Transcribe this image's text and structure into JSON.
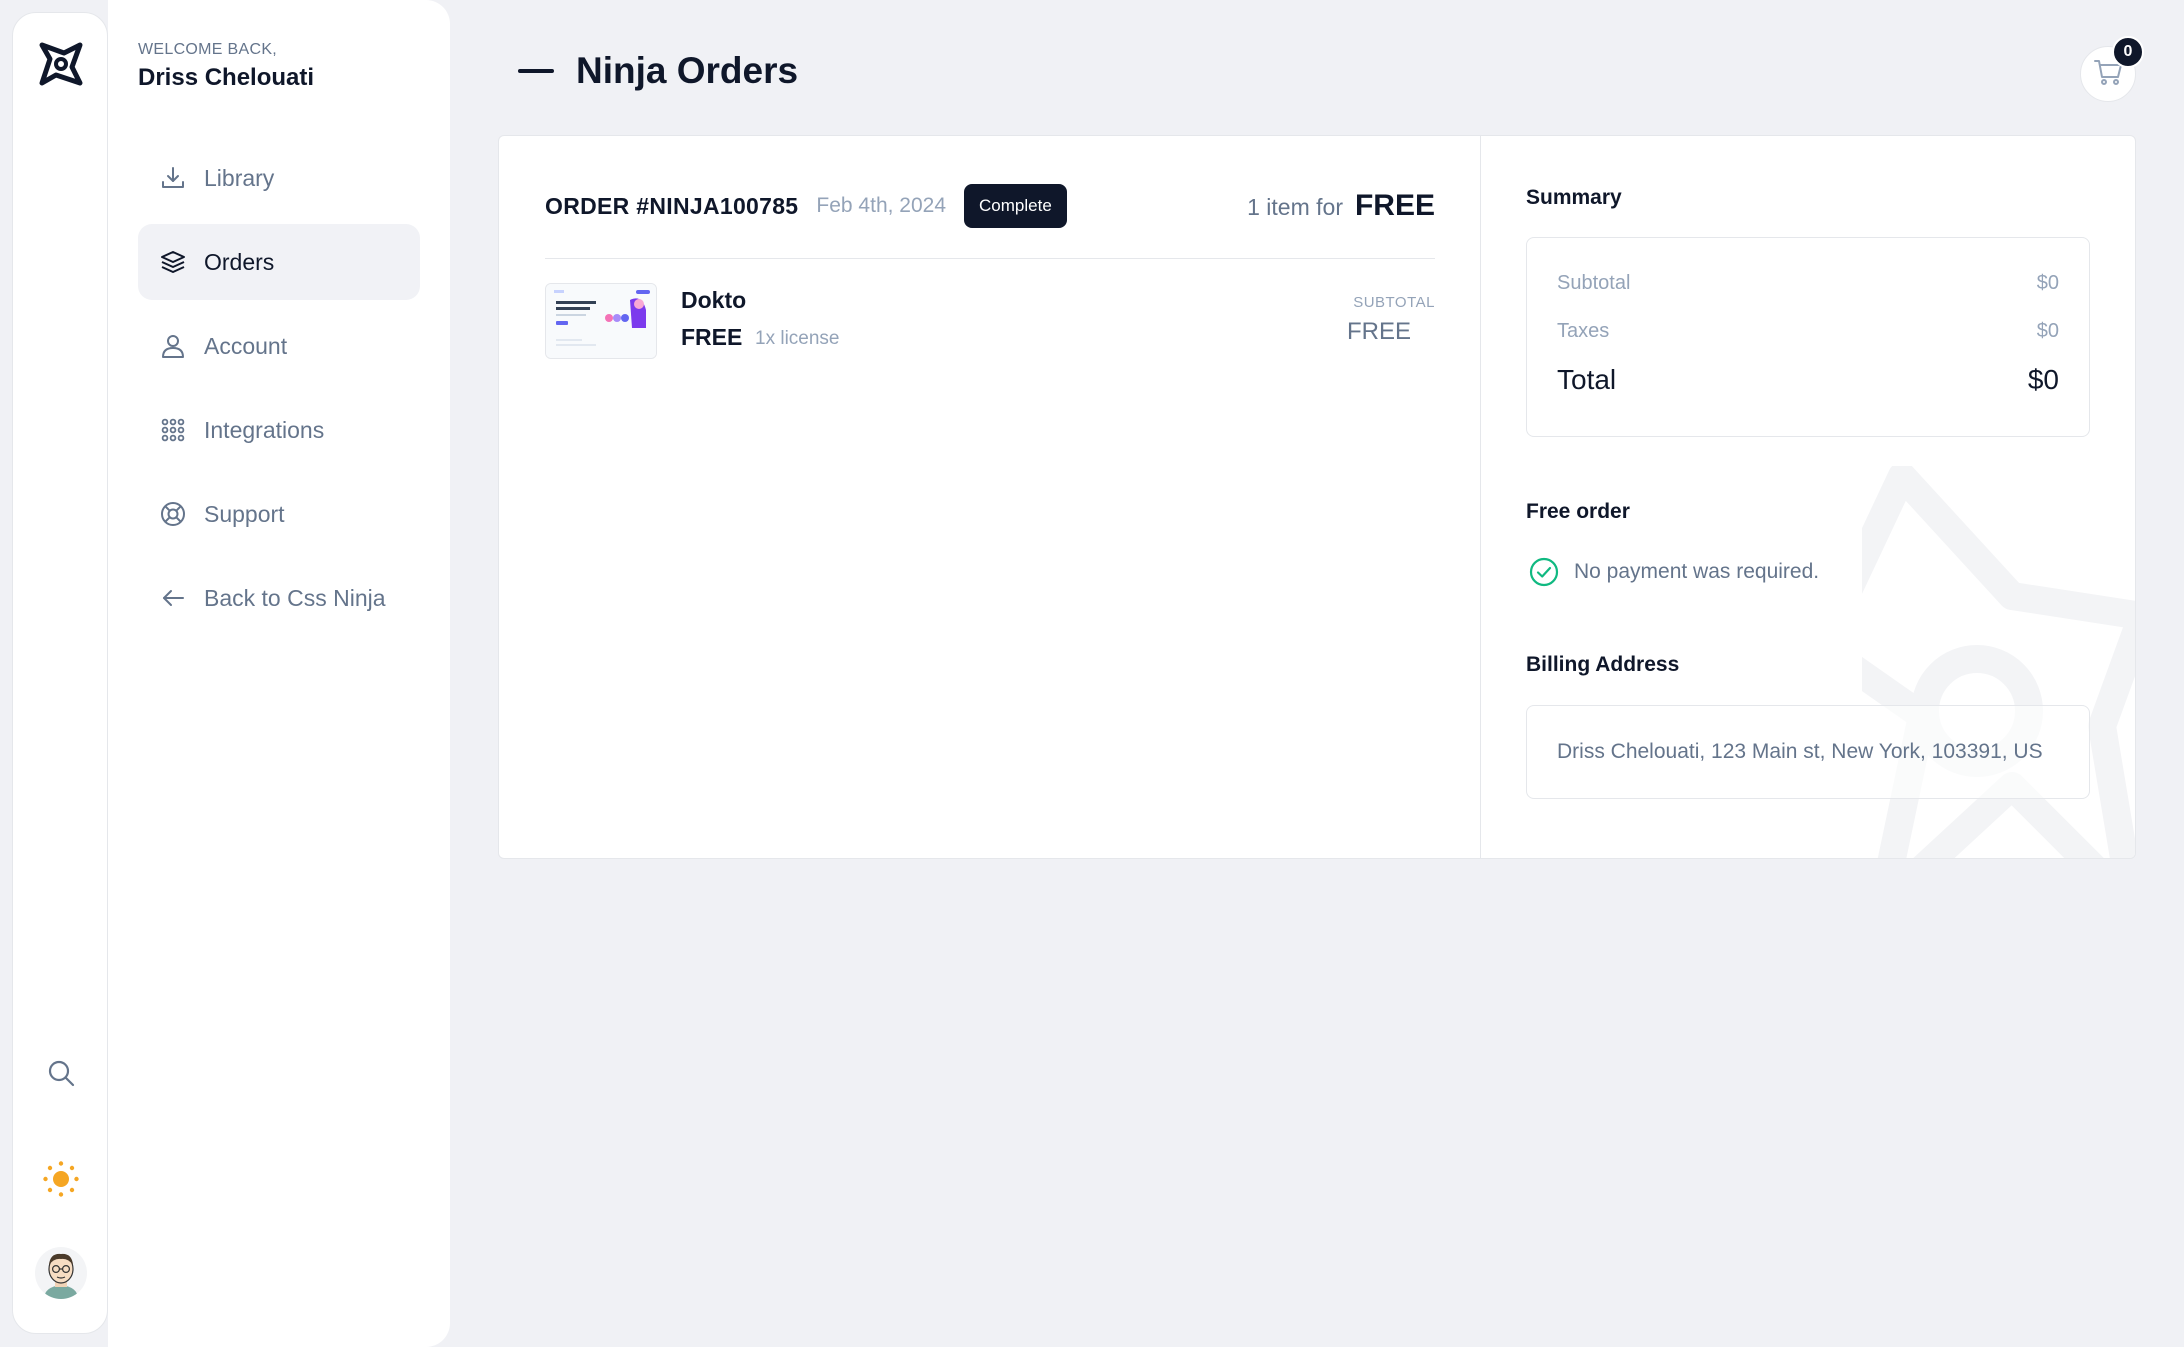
{
  "user": {
    "welcome": "WELCOME BACK,",
    "name": "Driss Chelouati"
  },
  "nav": {
    "items": [
      {
        "label": "Library",
        "icon": "download-icon"
      },
      {
        "label": "Orders",
        "icon": "layers-icon",
        "active": true
      },
      {
        "label": "Account",
        "icon": "user-icon"
      },
      {
        "label": "Integrations",
        "icon": "grid-icon"
      },
      {
        "label": "Support",
        "icon": "lifebuoy-icon"
      },
      {
        "label": "Back to Css Ninja",
        "icon": "arrow-left-icon"
      }
    ]
  },
  "rail": {
    "icons": [
      "ninja-logo-icon",
      "search-icon",
      "sun-icon",
      "avatar"
    ]
  },
  "header": {
    "title": "Ninja Orders",
    "cart_count": "0"
  },
  "order": {
    "number": "ORDER #NINJA100785",
    "date": "Feb 4th, 2024",
    "status": "Complete",
    "items_for": "1 item for",
    "total_label": "FREE",
    "item": {
      "name": "Dokto",
      "price": "FREE",
      "license": "1x license",
      "subtotal_label": "SUBTOTAL",
      "subtotal_value": "FREE"
    }
  },
  "summary": {
    "title": "Summary",
    "subtotal_label": "Subtotal",
    "subtotal_value": "$0",
    "taxes_label": "Taxes",
    "taxes_value": "$0",
    "total_label": "Total",
    "total_value": "$0"
  },
  "free_order": {
    "title": "Free order",
    "message": "No payment was required."
  },
  "billing": {
    "title": "Billing Address",
    "address": "Driss Chelouati, 123 Main st, New York, 103391, US"
  },
  "colors": {
    "accent": "#0f172a",
    "success": "#10b981",
    "sun": "#f5a623",
    "muted": "#64748b",
    "background": "#f0f1f5"
  }
}
